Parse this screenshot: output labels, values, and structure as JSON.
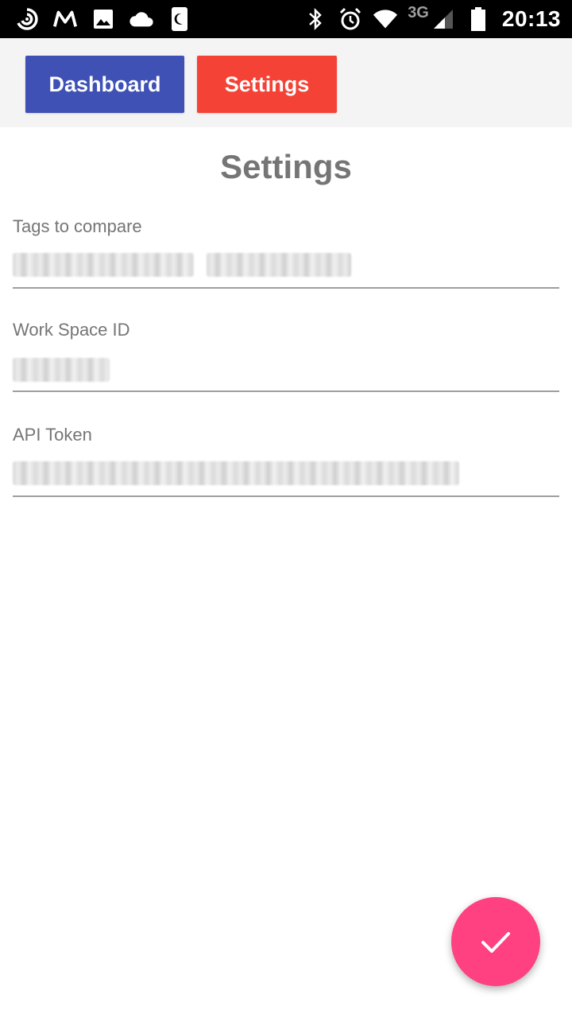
{
  "status_bar": {
    "time": "20:13",
    "network": "3G",
    "left_icons": [
      "cast-icon",
      "gmail-icon",
      "image-icon",
      "cloud-icon",
      "moon-icon"
    ],
    "right_icons": [
      "bluetooth-icon",
      "alarm-icon",
      "wifi-icon",
      "cell-signal-icon",
      "battery-icon"
    ]
  },
  "nav": {
    "dashboard_label": "Dashboard",
    "settings_label": "Settings",
    "colors": {
      "dashboard": "#3f51b5",
      "settings": "#f44336"
    }
  },
  "page": {
    "title": "Settings"
  },
  "fields": {
    "tags": {
      "label": "Tags to compare"
    },
    "workspace": {
      "label": "Work Space ID"
    },
    "token": {
      "label": "API Token"
    }
  },
  "fab": {
    "icon": "check-icon",
    "color": "#ff4081"
  }
}
